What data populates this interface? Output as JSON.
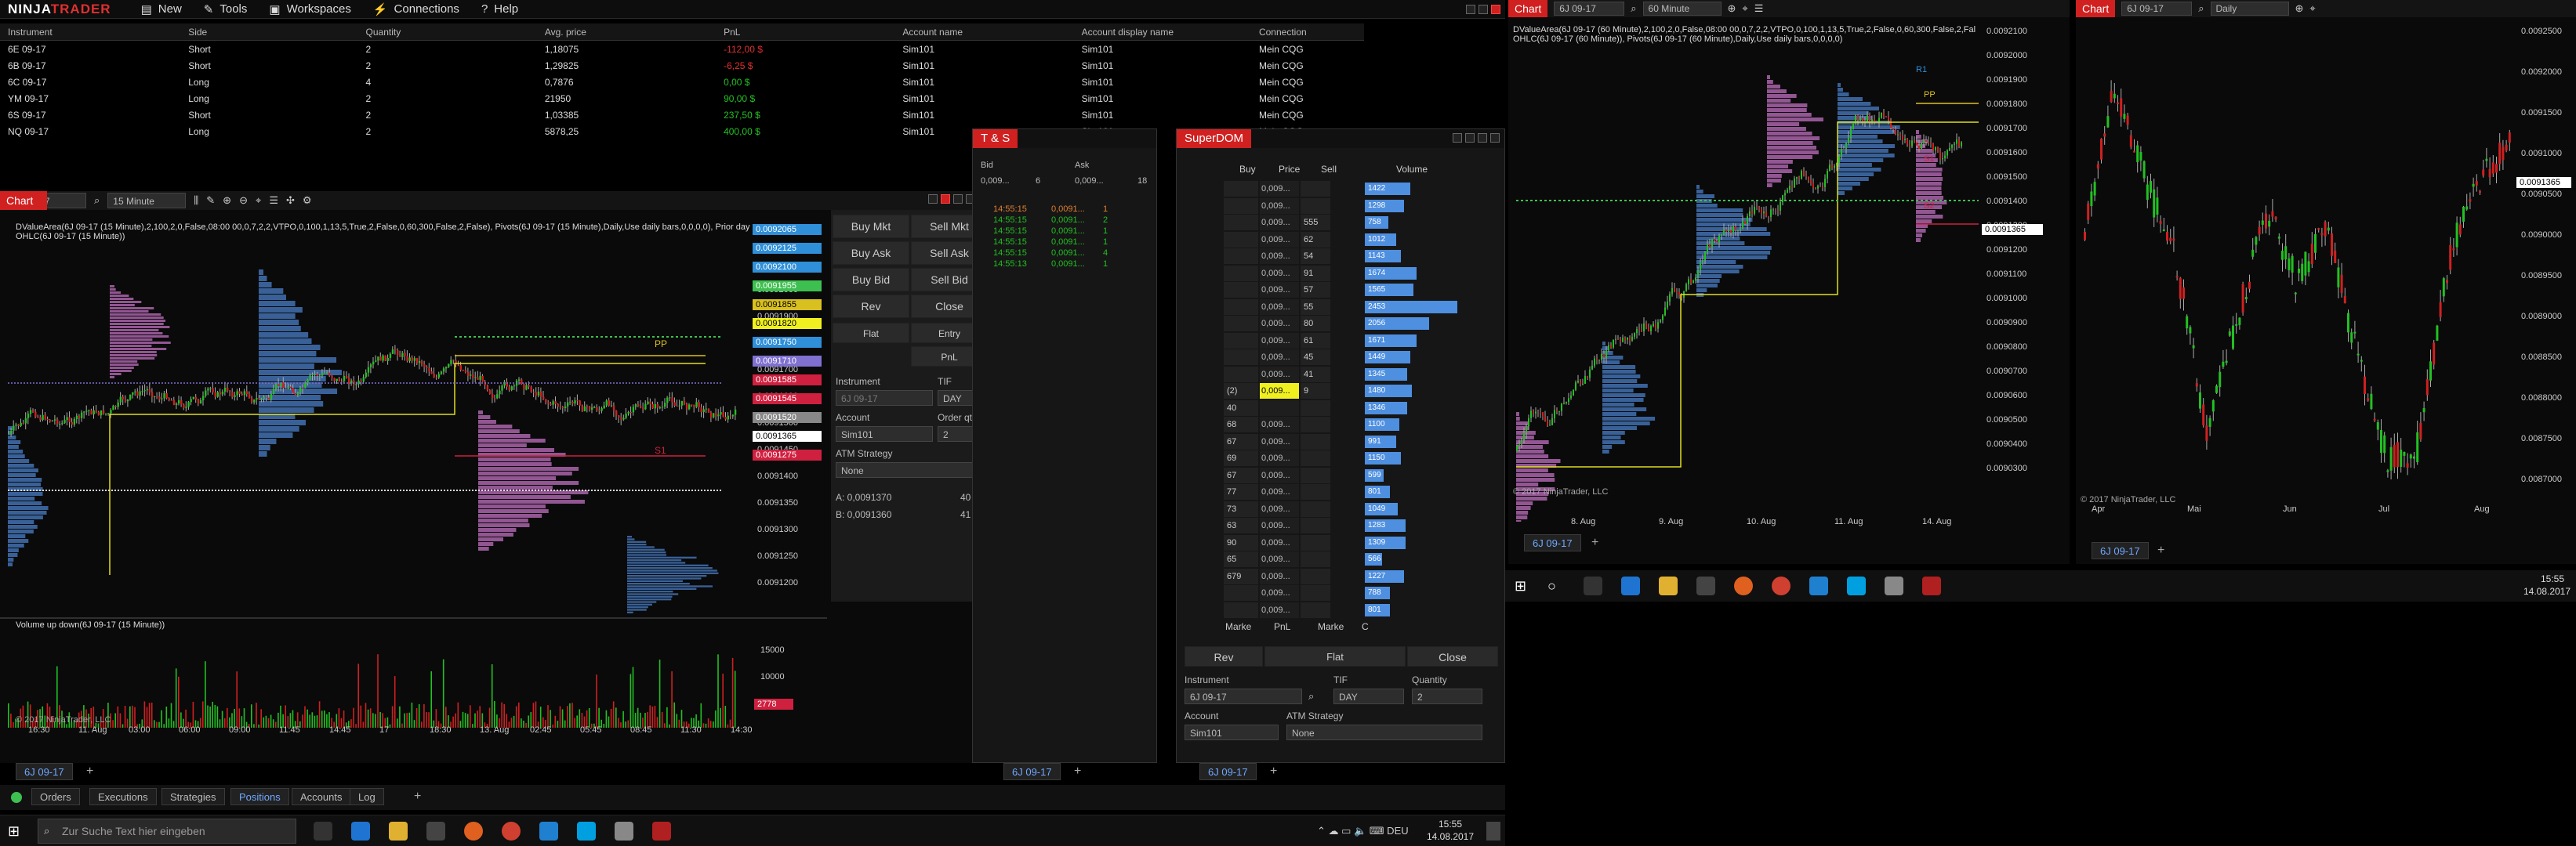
{
  "app": {
    "logo_a": "NINJA",
    "logo_b": "TRADER"
  },
  "menu": {
    "new": "New",
    "tools": "Tools",
    "workspaces": "Workspaces",
    "connections": "Connections",
    "help": "Help"
  },
  "positions": {
    "columns": [
      "Instrument",
      "Side",
      "Quantity",
      "Avg. price",
      "PnL",
      "Account name",
      "Account display name",
      "Connection"
    ],
    "rows": [
      [
        "6E 09-17",
        "Short",
        "2",
        "1,18075",
        "-112,00 $",
        "Sim101",
        "Sim101",
        "Mein CQG"
      ],
      [
        "6B 09-17",
        "Short",
        "2",
        "1,29825",
        "-6,25 $",
        "Sim101",
        "Sim101",
        "Mein CQG"
      ],
      [
        "6C 09-17",
        "Long",
        "4",
        "0,7876",
        "0,00 $",
        "Sim101",
        "Sim101",
        "Mein CQG"
      ],
      [
        "YM 09-17",
        "Long",
        "2",
        "21950",
        "90,00 $",
        "Sim101",
        "Sim101",
        "Mein CQG"
      ],
      [
        "6S 09-17",
        "Short",
        "2",
        "1,03385",
        "237,50 $",
        "Sim101",
        "Sim101",
        "Mein CQG"
      ],
      [
        "NQ 09-17",
        "Long",
        "2",
        "5878,25",
        "400,00 $",
        "Sim101",
        "Sim101",
        "Mein CQG"
      ]
    ]
  },
  "bottom_tabs": {
    "orders": "Orders",
    "executions": "Executions",
    "strategies": "Strategies",
    "positions": "Positions",
    "accounts": "Accounts",
    "log": "Log"
  },
  "chart1": {
    "title": "Chart",
    "instrument": "6J 09-17",
    "interval": "15 Minute",
    "indicator_line1": "DValueArea(6J 09-17 (15 Minute),2,100,2,0,False,08:00 00,0,7,2,2,VTPO,0,100,1,13,5,True,2,False,0,60,300,False,2,False), Pivots(6J 09-17 (15 Minute),Daily,Use daily bars,0,0,0,0), Prior day",
    "indicator_line2": "OHLC(6J 09-17 (15 Minute))",
    "volume_label": "Volume up down(6J 09-17 (15 Minute))",
    "copyright": "© 2017 NinjaTrader, LLC",
    "price_labels": [
      "0.0092000",
      "0.0091900",
      "0.0091800",
      "0.0091700",
      "0.0091600",
      "0.0091500",
      "0.0091450",
      "0.0091400",
      "0.0091350",
      "0.0091300",
      "0.0091250",
      "0.0091200"
    ],
    "highlighted": [
      {
        "text": "0.0092065",
        "color": "#2f8fd8"
      },
      {
        "text": "0.0092125",
        "color": "#2f8fd8"
      },
      {
        "text": "0.0092100",
        "color": "#2f8fd8"
      },
      {
        "text": "0.0091955",
        "color": "#3ec050"
      },
      {
        "text": "0.0091855",
        "color": "#d8c020"
      },
      {
        "text": "0.0091820",
        "color": "#f0f020"
      },
      {
        "text": "0.0091750",
        "color": "#2f8fd8"
      },
      {
        "text": "0.0091710",
        "color": "#8070d0"
      },
      {
        "text": "0.0091585",
        "color": "#d02040"
      },
      {
        "text": "0.0091545",
        "color": "#d02040"
      },
      {
        "text": "0.0091520",
        "color": "#888888"
      },
      {
        "text": "0.0091365",
        "color": "#ffffff"
      },
      {
        "text": "0.0091275",
        "color": "#d02040"
      }
    ],
    "vol_labels": [
      "15000",
      "10000",
      "5000"
    ],
    "vol_current": "2778",
    "pp": "PP",
    "s1": "S1",
    "time_labels": [
      "16:30",
      "11. Aug",
      "03:00",
      "06:00",
      "09:00",
      "11:45",
      "14:45",
      "17",
      "18:30",
      "13. Aug",
      "02:45",
      "05:45",
      "08:45",
      "11:30",
      "14:30"
    ],
    "tab": "6J 09-17"
  },
  "chart_trader": {
    "buy_mkt": "Buy Mkt",
    "sell_mkt": "Sell Mkt",
    "buy_ask": "Buy Ask",
    "sell_ask": "Sell Ask",
    "buy_bid": "Buy Bid",
    "sell_bid": "Sell Bid",
    "rev": "Rev",
    "close": "Close",
    "flat": "Flat",
    "entry": "Entry",
    "pnl": "PnL",
    "instrument_lbl": "Instrument",
    "instrument_val": "6J 09-17",
    "tif_lbl": "TIF",
    "tif_val": "DAY",
    "account_lbl": "Account",
    "account_val": "Sim101",
    "qty_lbl": "Order qty",
    "qty_val": "2",
    "atm_lbl": "ATM Strategy",
    "atm_val": "None",
    "a_line": "A:  0,0091370",
    "a_qty": "40",
    "b_line": "B:  0,0091360",
    "b_qty": "41"
  },
  "ts": {
    "title": "T & S",
    "bid_hdr": "Bid",
    "ask_hdr": "Ask",
    "bid_val": "0,009...",
    "bid_sz": "6",
    "ask_val": "0,009...",
    "ask_sz": "18",
    "rows": [
      {
        "time": "14:55:15",
        "price": "0,0091...",
        "qty": "1",
        "color": "#e08030"
      },
      {
        "time": "14:55:15",
        "price": "0,0091...",
        "qty": "2",
        "color": "#22c022"
      },
      {
        "time": "14:55:15",
        "price": "0,0091...",
        "qty": "1",
        "color": "#22c022"
      },
      {
        "time": "14:55:15",
        "price": "0,0091...",
        "qty": "1",
        "color": "#22c022"
      },
      {
        "time": "14:55:15",
        "price": "0,0091...",
        "qty": "4",
        "color": "#22c022"
      },
      {
        "time": "14:55:13",
        "price": "0,0091...",
        "qty": "1",
        "color": "#22c022"
      }
    ],
    "tab": "6J 09-17"
  },
  "superdom": {
    "title": "SuperDOM",
    "buy_hdr": "Buy",
    "price_hdr": "Price",
    "sell_hdr": "Sell",
    "volume_hdr": "Volume",
    "rows": [
      {
        "buy": "",
        "price": "0,009...",
        "sell": "",
        "vol": "1422",
        "w": 58
      },
      {
        "buy": "",
        "price": "0,009...",
        "sell": "",
        "vol": "1298",
        "w": 50
      },
      {
        "buy": "",
        "price": "0,009...",
        "sell": "555",
        "vol": "758",
        "w": 30
      },
      {
        "buy": "",
        "price": "0,009...",
        "sell": "62",
        "vol": "1012",
        "w": 40
      },
      {
        "buy": "",
        "price": "0,009...",
        "sell": "54",
        "vol": "1143",
        "w": 46
      },
      {
        "buy": "",
        "price": "0,009...",
        "sell": "91",
        "vol": "1674",
        "w": 66
      },
      {
        "buy": "",
        "price": "0,009...",
        "sell": "57",
        "vol": "1565",
        "w": 62
      },
      {
        "buy": "",
        "price": "0,009...",
        "sell": "55",
        "vol": "2453",
        "w": 118
      },
      {
        "buy": "",
        "price": "0,009...",
        "sell": "80",
        "vol": "2056",
        "w": 82
      },
      {
        "buy": "",
        "price": "0,009...",
        "sell": "61",
        "vol": "1671",
        "w": 66
      },
      {
        "buy": "",
        "price": "0,009...",
        "sell": "45",
        "vol": "1449",
        "w": 58
      },
      {
        "buy": "",
        "price": "0,009...",
        "sell": "41",
        "vol": "1345",
        "w": 54
      },
      {
        "buy": "(2)",
        "price": "0,009...",
        "sell": "9",
        "vol": "1480",
        "w": 60
      },
      {
        "buy": "40",
        "price": "",
        "sell": "",
        "vol": "1346",
        "w": 54
      },
      {
        "buy": "68",
        "price": "0,009...",
        "sell": "",
        "vol": "1100",
        "w": 44
      },
      {
        "buy": "67",
        "price": "0,009...",
        "sell": "",
        "vol": "991",
        "w": 40
      },
      {
        "buy": "69",
        "price": "0,009...",
        "sell": "",
        "vol": "1150",
        "w": 46
      },
      {
        "buy": "67",
        "price": "0,009...",
        "sell": "",
        "vol": "599",
        "w": 24
      },
      {
        "buy": "77",
        "price": "0,009...",
        "sell": "",
        "vol": "801",
        "w": 32
      },
      {
        "buy": "73",
        "price": "0,009...",
        "sell": "",
        "vol": "1049",
        "w": 42
      },
      {
        "buy": "63",
        "price": "0,009...",
        "sell": "",
        "vol": "1283",
        "w": 52
      },
      {
        "buy": "90",
        "price": "0,009...",
        "sell": "",
        "vol": "1309",
        "w": 52
      },
      {
        "buy": "65",
        "price": "0,009...",
        "sell": "",
        "vol": "566",
        "w": 22
      },
      {
        "buy": "679",
        "price": "0,009...",
        "sell": "",
        "vol": "1227",
        "w": 50
      },
      {
        "buy": "",
        "price": "0,009...",
        "sell": "",
        "vol": "788",
        "w": 32
      },
      {
        "buy": "",
        "price": "0,009...",
        "sell": "",
        "vol": "801",
        "w": 32
      }
    ],
    "marke1": "Marke",
    "pnl": "PnL",
    "marke2": "Marke",
    "c": "C",
    "rev": "Rev",
    "flat": "Flat",
    "close": "Close",
    "instrument_lbl": "Instrument",
    "instrument_val": "6J 09-17",
    "tif_lbl": "TIF",
    "tif_val": "DAY",
    "qty_lbl": "Quantity",
    "qty_val": "2",
    "account_lbl": "Account",
    "account_val": "Sim101",
    "atm_lbl": "ATM Strategy",
    "atm_val": "None",
    "tab": "6J 09-17"
  },
  "chart2": {
    "title": "Chart",
    "instrument": "6J 09-17",
    "interval": "60 Minute",
    "indicator_line1": "DValueArea(6J 09-17 (60 Minute),2,100,2,0,False,08:00 00,0,7,2,2,VTPO,0,100,1,13,5,True,2,False,0,60,300,False,2,False), Prior day",
    "indicator_line2": "OHLC(6J 09-17 (60 Minute)), Pivots(6J 09-17 (60 Minute),Daily,Use daily bars,0,0,0,0)",
    "copyright": "© 2017 NinjaTrader, LLC",
    "price_labels": [
      "0.0092100",
      "0.0092000",
      "0.0091900",
      "0.0091800",
      "0.0091700",
      "0.0091600",
      "0.0091500",
      "0.0091400",
      "0.0091300",
      "0.0091200",
      "0.0091100",
      "0.0091000",
      "0.0090900",
      "0.0090800",
      "0.0090700",
      "0.0090600",
      "0.0090500",
      "0.0090400",
      "0.0090300"
    ],
    "current": "0.0091365",
    "r1": "R1",
    "pp": "PP",
    "s1": "S1",
    "s2": "S2",
    "time_labels": [
      "8. Aug",
      "9. Aug",
      "10. Aug",
      "11. Aug",
      "14. Aug"
    ],
    "tab": "6J 09-17"
  },
  "chart3": {
    "title": "Chart",
    "instrument": "6J 09-17",
    "interval": "Daily",
    "copyright": "© 2017 NinjaTrader, LLC",
    "price_labels": [
      "0.0092500",
      "0.0092000",
      "0.0091500",
      "0.0091000",
      "0.0090500",
      "0.0090000",
      "0.0089500",
      "0.0089000",
      "0.0088500",
      "0.0088000",
      "0.0087500",
      "0.0087000"
    ],
    "current": "0.0091365",
    "time_labels": [
      "Apr",
      "Mai",
      "Jun",
      "Jul",
      "Aug"
    ],
    "tab": "6J 09-17"
  },
  "taskbar1": {
    "search": "Zur Suche Text hier eingeben",
    "time": "15:55",
    "date": "14.08.2017"
  },
  "taskbar2": {
    "time": "15:55",
    "date": "14.08.2017"
  }
}
